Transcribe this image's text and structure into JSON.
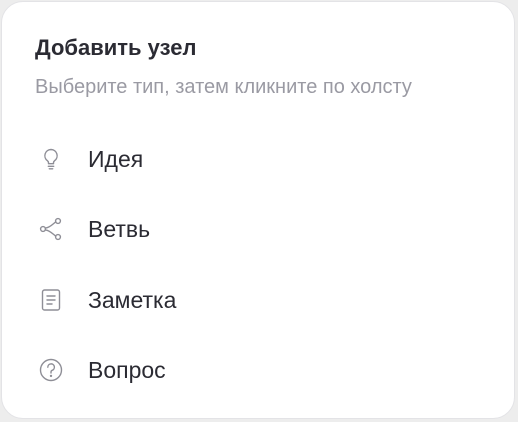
{
  "panel": {
    "title": "Добавить узел",
    "subtitle": "Выберите тип, затем кликните по холсту"
  },
  "node_types": [
    {
      "label": "Идея",
      "icon": "lightbulb-icon"
    },
    {
      "label": "Ветвь",
      "icon": "branch-icon"
    },
    {
      "label": "Заметка",
      "icon": "note-icon"
    },
    {
      "label": "Вопрос",
      "icon": "question-icon"
    }
  ],
  "colors": {
    "text": "#2b2b33",
    "muted": "#9a9aa3",
    "icon": "#8e8e96",
    "border": "#e3e3e6"
  }
}
